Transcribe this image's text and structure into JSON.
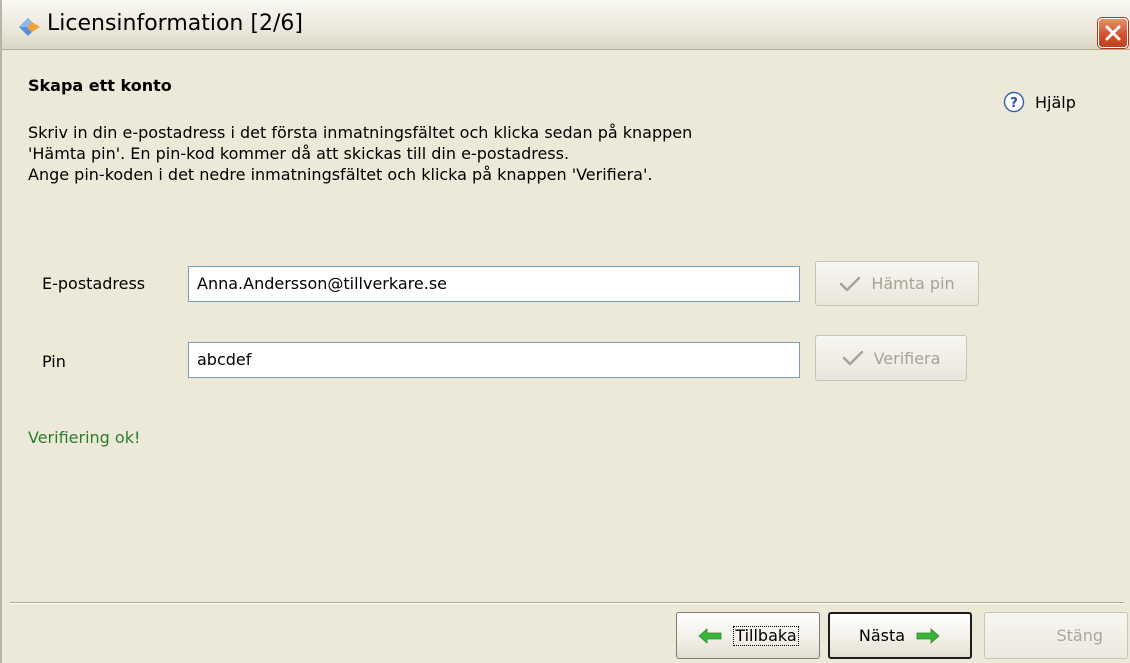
{
  "window": {
    "title": "Licensinformation [2/6]",
    "app_icon": "diamond-arrow-icon",
    "close_icon": "close-icon"
  },
  "page": {
    "heading": "Skapa ett konto",
    "help_label": "Hjälp",
    "help_icon": "question-mark-icon",
    "description": [
      "Skriv in din e-postadress i det första inmatningsfältet och klicka sedan på knappen",
      "'Hämta pin'. En pin-kod kommer då att skickas till din e-postadress.",
      "Ange pin-koden i det nedre inmatningsfältet och klicka på knappen 'Verifiera'."
    ]
  },
  "form": {
    "email_label": "E-postadress",
    "email_value": "Anna.Andersson@tillverkare.se",
    "get_pin_label": "Hämta pin",
    "get_pin_enabled": false,
    "pin_label": "Pin",
    "pin_value": "abcdef",
    "verify_label": "Verifiera",
    "verify_enabled": false,
    "status_message": "Verifiering ok!"
  },
  "footer": {
    "back_label": "Tillbaka",
    "next_label": "Nästa",
    "close_label": "Stäng",
    "close_enabled": false
  },
  "colors": {
    "window_bg": "#ece9d8",
    "status_ok": "#2e7d2e",
    "arrow_green": "#3cb43c",
    "disabled_text": "#a7a396",
    "close_red": "#d0502c"
  }
}
